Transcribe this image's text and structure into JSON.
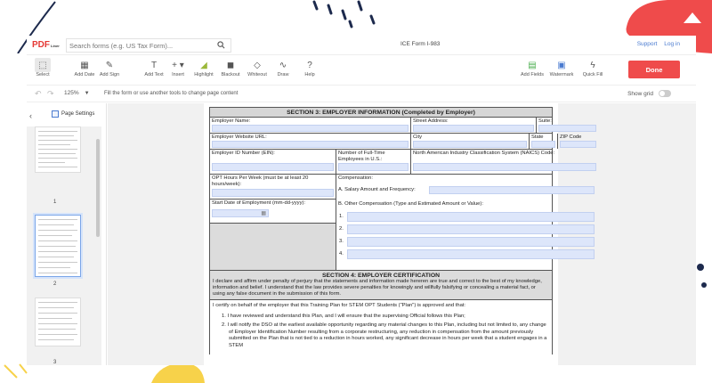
{
  "app": {
    "logo_main": "PDF",
    "logo_sub": "Liner",
    "search_placeholder": "Search forms (e.g. US Tax Form)...",
    "doc_title": "ICE Form I-983",
    "support_label": "Support",
    "login_label": "Log in"
  },
  "toolbar": {
    "select": "Select",
    "add_date": "Add Date",
    "add_sign": "Add Sign",
    "add_text": "Add Text",
    "insert": "Insert",
    "highlight": "Highlight",
    "blackout": "Blackout",
    "whiteout": "Whiteout",
    "draw": "Draw",
    "help": "Help",
    "add_fields": "Add Fields",
    "watermark": "Watermark",
    "quick_fill": "Quick Fill",
    "done": "Done"
  },
  "subbar": {
    "zoom": "125%",
    "hint": "Fill the form or use another tools to change page content",
    "show_grid": "Show grid"
  },
  "sidebar": {
    "page_settings": "Page Settings",
    "pages": [
      "1",
      "2",
      "3"
    ]
  },
  "form": {
    "sec3_title": "SECTION 3: EMPLOYER INFORMATION (Completed by Employer)",
    "employer_name": "Employer Name:",
    "street_address": "Street Address:",
    "suite": "Suite:",
    "website": "Employer Website URL:",
    "city": "City",
    "state": "State",
    "zip": "ZIP Code",
    "ein": "Employer ID Number (EIN):",
    "num_employees": "Number of Full-Time Employees in U.S.:",
    "naics": "North American Industry Classification System (NAICS) Code:",
    "opt_hours": "OPT Hours Per Week (must be at least 20 hours/week):",
    "compensation": "Compensation:",
    "salary": "A.  Salary Amount and Frequency:",
    "start_date": "Start Date of Employment (mm-dd-yyyy):",
    "other_comp": "B.  Other Compensation (Type and Estimated Amount or Value):",
    "list_nums": [
      "1.",
      "2.",
      "3.",
      "4."
    ],
    "sec4_title": "SECTION 4: EMPLOYER CERTIFICATION",
    "sec4_text": "I declare and affirm under penalty of perjury that the statements and information made hereren are true and correct to the best of my knowledge, information and belief. I understand that the law provides severe penalties for knowingly and willfully falsifying or concealing a material fact, or using any false document in the submission of this form.",
    "certify": "I certify on behalf of the employer that this Training Plan for STEM OPT Students (\"Plan\") is approved and that:",
    "item1": "1.  I have reviewed and understand this Plan, and I will ensure that the supervising Official follows this Plan;",
    "item2": "2.  I will notify the DSO at the earliest available opportunity regarding any material changes to this Plan, including but not limited to, any change of Employer Identification Number resulting from a corporate restructuring, any reduction in compensation from the amount previously submitted on the Plan that is not tied to a reduction in hours worked, any significant decrease in hours per week that a student engages in a STEM"
  }
}
